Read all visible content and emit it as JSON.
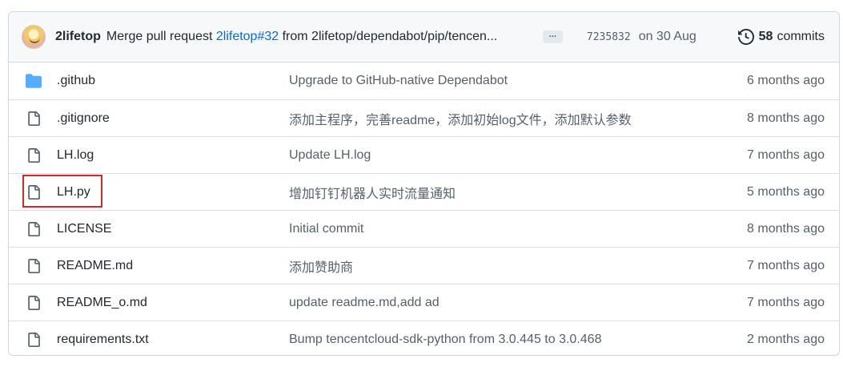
{
  "commit": {
    "author": "2lifetop",
    "message_prefix": "Merge pull request",
    "pr_ref": "2lifetop#32",
    "message_suffix": "from 2lifetop/dependabot/pip/tencen...",
    "ellipsis": "...",
    "sha": "7235832",
    "date": "on 30 Aug",
    "commit_count": "58",
    "commits_label": "commits"
  },
  "files": [
    {
      "name": ".github",
      "type": "folder",
      "message": "Upgrade to GitHub-native Dependabot",
      "age": "6 months ago"
    },
    {
      "name": ".gitignore",
      "type": "file",
      "message": "添加主程序，完善readme，添加初始log文件，添加默认参数",
      "age": "8 months ago"
    },
    {
      "name": "LH.log",
      "type": "file",
      "message": "Update LH.log",
      "age": "7 months ago"
    },
    {
      "name": "LH.py",
      "type": "file",
      "message": "增加钉钉机器人实时流量通知",
      "age": "5 months ago"
    },
    {
      "name": "LICENSE",
      "type": "file",
      "message": "Initial commit",
      "age": "8 months ago"
    },
    {
      "name": "README.md",
      "type": "file",
      "message": "添加赞助商",
      "age": "7 months ago"
    },
    {
      "name": "README_o.md",
      "type": "file",
      "message": "update readme.md,add ad",
      "age": "7 months ago"
    },
    {
      "name": "requirements.txt",
      "type": "file",
      "message": "Bump tencentcloud-sdk-python from 3.0.445 to 3.0.468",
      "age": "2 months ago"
    }
  ],
  "colors": {
    "folder": "#54aeff",
    "file_icon": "#57606a",
    "link": "#0969da",
    "highlight": "#d62828"
  },
  "icons": {
    "folder": "folder-icon",
    "file": "file-icon",
    "history": "history-icon"
  }
}
